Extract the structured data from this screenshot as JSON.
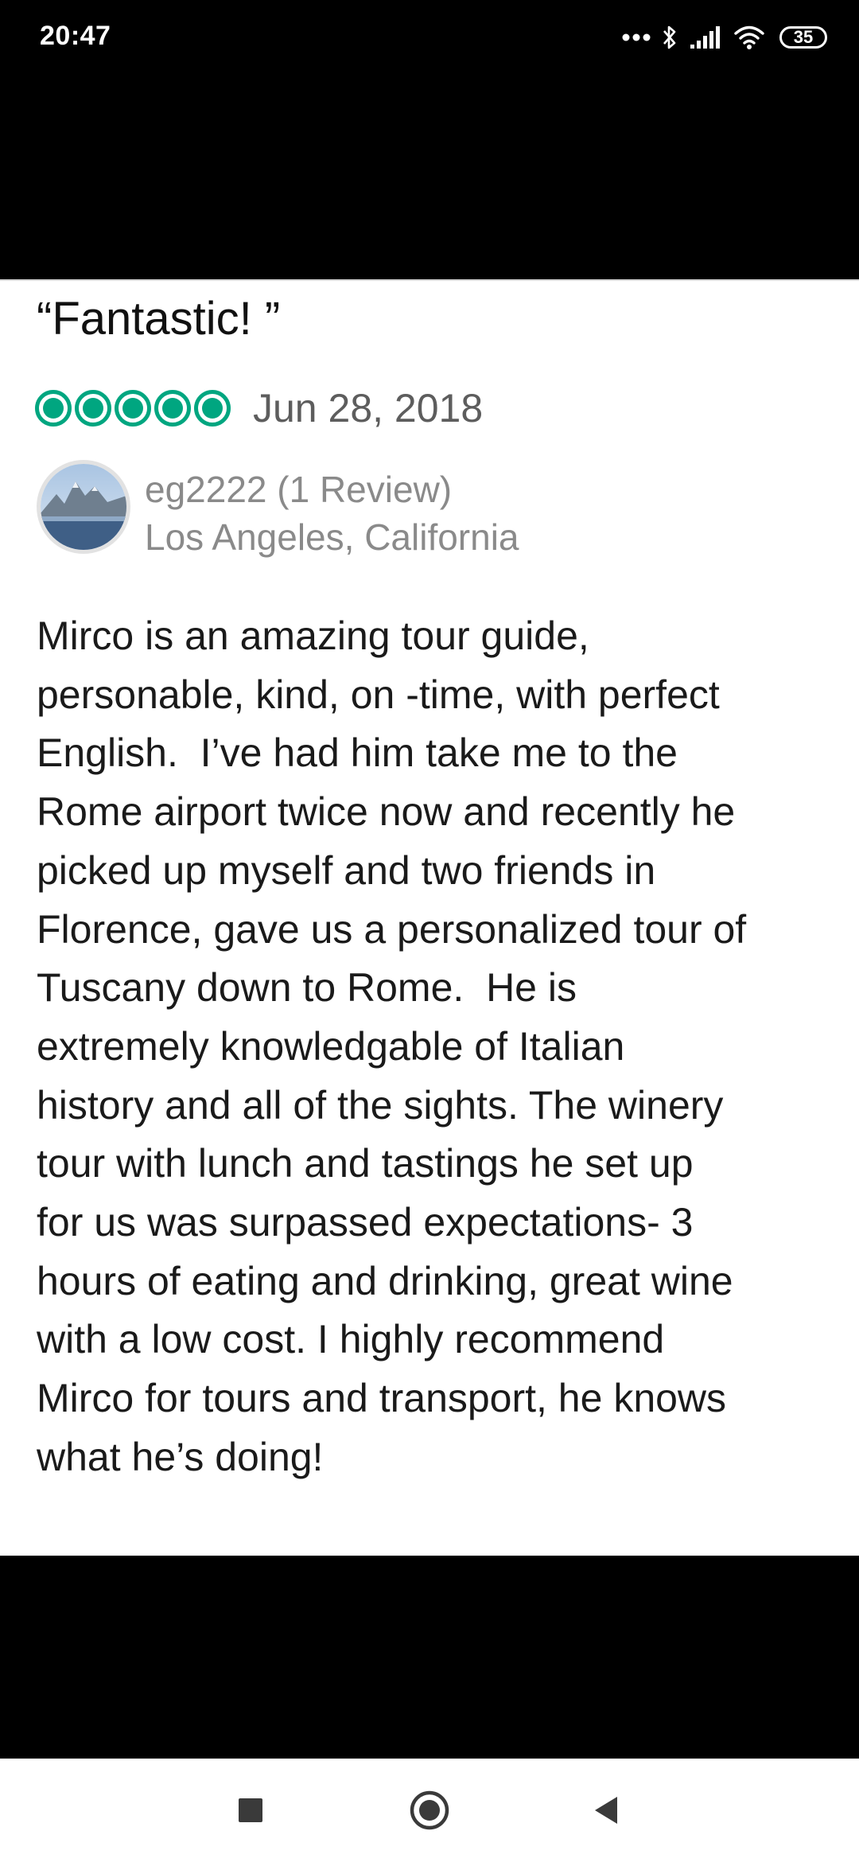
{
  "status_bar": {
    "time": "20:47",
    "battery": "35",
    "icons": [
      "more-dots-icon",
      "bluetooth-icon",
      "signal-icon",
      "wifi-icon",
      "battery-icon"
    ]
  },
  "review": {
    "title": "“Fantastic! ”",
    "rating": 5,
    "rating_max": 5,
    "rating_color": "#00a680",
    "date": "Jun 28, 2018",
    "reviewer": {
      "name": "eg2222 (1 Review)",
      "location": "Los Angeles, California"
    },
    "body_lines": [
      "Mirco is an amazing tour guide,",
      "personable, kind, on -time, with perfect",
      "English.  I’ve had him take me to the",
      "Rome airport twice now and recently he",
      "picked up myself and two friends in",
      "Florence, gave us a personalized tour of",
      "Tuscany down to Rome.  He is",
      "extremely knowledgable of Italian",
      "history and all of the sights. The winery",
      "tour with lunch and tastings he set up",
      "for us was surpassed expectations- 3",
      "hours of eating and drinking, great wine",
      "with a low cost. I highly recommend",
      "Mirco for tours and transport, he knows",
      "what he’s doing!"
    ]
  },
  "nav_bar": {
    "buttons": [
      "recent-apps-icon",
      "home-icon",
      "back-icon"
    ]
  }
}
